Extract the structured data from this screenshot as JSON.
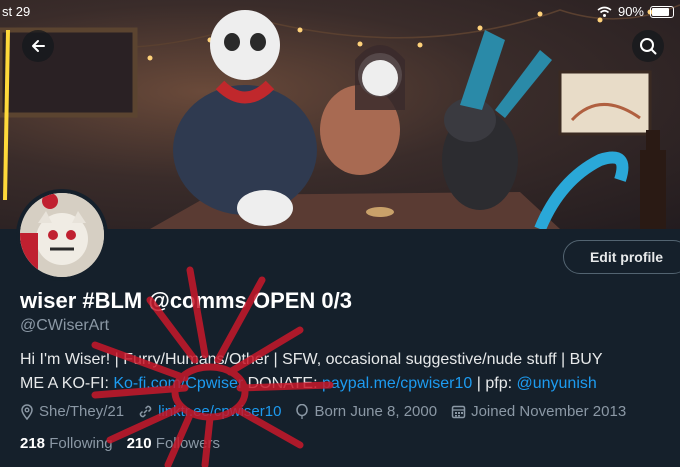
{
  "status_bar": {
    "time": "st 29",
    "battery": "90%"
  },
  "profile": {
    "display_name": "wiser #BLM @comms OPEN 0/3",
    "handle": "@CWiserArt",
    "edit_button": "Edit profile",
    "bio": {
      "line1": "Hi I'm Wiser! | Furry/Humans/Other | SFW, occasional suggestive/nude stuff | BUY",
      "line2_prefix": "ME A KO-FI: ",
      "kofi_link": "Ko-fi.com/Cpwiser",
      "donate_label": " DONATE: ",
      "paypal_link": "paypal.me/cpwiser10",
      "pfp_label": " | pfp: ",
      "pfp_link": "@unyunish"
    },
    "meta": {
      "pronouns": "She/They/21",
      "website": "linktr.ee/cpwiser10",
      "birthday": "Born June 8, 2000",
      "joined": "Joined November 2013"
    },
    "following_count": "218",
    "following_label": "Following",
    "followers_count": "210",
    "followers_label": "Followers"
  },
  "icons": [
    "back-arrow-icon",
    "search-icon",
    "wifi-icon",
    "battery-icon",
    "location-icon",
    "link-icon",
    "balloon-icon",
    "calendar-icon"
  ],
  "colors": {
    "background": "#15202b",
    "link": "#1d9bf0",
    "muted": "#8b98a5",
    "scribble": "#c8182a"
  }
}
